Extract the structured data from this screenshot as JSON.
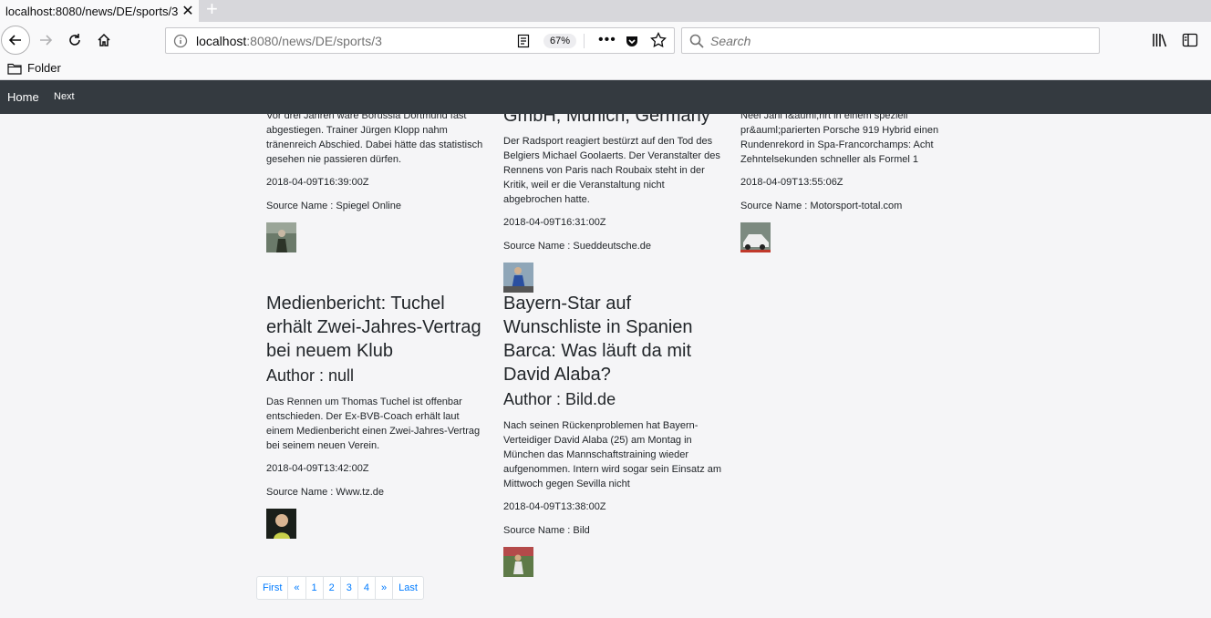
{
  "browser": {
    "tab_title": "localhost:8080/news/DE/sports/3",
    "url_host": "localhost",
    "url_path": ":8080/news/DE/sports/3",
    "zoom": "67%",
    "search_placeholder": "Search",
    "bookmark_folder": "Folder"
  },
  "site_nav": {
    "home": "Home",
    "next": "Next"
  },
  "articles": [
    {
      "description": "Vor drei Jahren wäre Borussia Dortmund fast abgestiegen. Trainer Jürgen Klopp nahm tränenreich Abschied. Dabei hätte das statistisch gesehen nie passieren dürfen.",
      "date": "2018-04-09T16:39:00Z",
      "source": "Source Name : Spiegel Online"
    },
    {
      "title_fragment": "GmbH, Munich, Germany",
      "description": "Der Radsport reagiert bestürzt auf den Tod des Belgiers Michael Goolaerts. Der Veranstalter des Rennens von Paris nach Roubaix steht in der Kritik, weil er die Veranstaltung nicht abgebrochen hatte.",
      "date": "2018-04-09T16:31:00Z",
      "source": "Source Name : Sueddeutsche.de"
    },
    {
      "description": "Neel Jani f&auml;hrt in einem speziell pr&auml;parierten Porsche 919 Hybrid einen Rundenrekord in Spa-Francorchamps: Acht Zehntelsekunden schneller als Formel 1",
      "date": "2018-04-09T13:55:06Z",
      "source": "Source Name : Motorsport-total.com"
    },
    {
      "title": "Medienbericht: Tuchel erhält Zwei-Jahres-Vertrag bei neuem Klub",
      "author": "Author : null",
      "description": "Das Rennen um Thomas Tuchel ist offenbar entschieden. Der Ex-BVB-Coach erhält laut einem Medienbericht einen Zwei-Jahres-Vertrag bei seinem neuen Verein.",
      "date": "2018-04-09T13:42:00Z",
      "source": "Source Name : Www.tz.de"
    },
    {
      "title": "Bayern-Star auf Wunschliste in Spanien Barca: Was läuft da mit David Alaba?",
      "author": "Author : Bild.de",
      "description": "Nach seinen Rückenproblemen hat Bayern-Verteidiger David Alaba (25) am Montag in München das Mannschaftstraining wieder aufgenommen. Intern wird sogar sein Einsatz am Mittwoch gegen Sevilla nicht",
      "date": "2018-04-09T13:38:00Z",
      "source": "Source Name : Bild"
    }
  ],
  "pagination": [
    "First",
    "«",
    "1",
    "2",
    "3",
    "4",
    "»",
    "Last"
  ]
}
